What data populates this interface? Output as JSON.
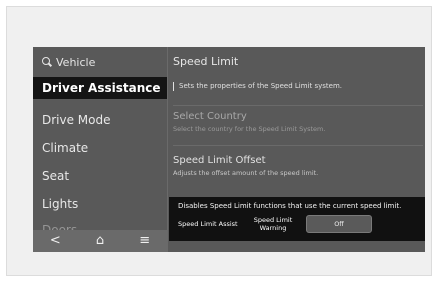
{
  "sidebar": {
    "header": "Vehicle",
    "items": [
      {
        "label": "Driver Assistance"
      },
      {
        "label": "Drive Mode"
      },
      {
        "label": "Climate"
      },
      {
        "label": "Seat"
      },
      {
        "label": "Lights"
      },
      {
        "label": "Doors"
      }
    ]
  },
  "nav": {
    "back": "<",
    "home": "⌂",
    "menu": "≡"
  },
  "content": {
    "title": "Speed Limit",
    "description": "Sets the properties of the Speed Limit system.",
    "settings": [
      {
        "label": "Select Country",
        "sub": "Select the country for the Speed Limit System."
      },
      {
        "label": "Speed Limit Offset",
        "sub": "Adjusts the offset amount of the speed limit."
      }
    ]
  },
  "popup": {
    "message": "Disables Speed Limit functions that use the current speed limit.",
    "assist_label": "Speed Limit Assist",
    "warning_label": "Speed Limit Warning",
    "toggle_value": "Off"
  },
  "colors": {
    "screen_bg": "#595959",
    "active_item_bg": "#141414",
    "popup_bg": "#111111"
  }
}
